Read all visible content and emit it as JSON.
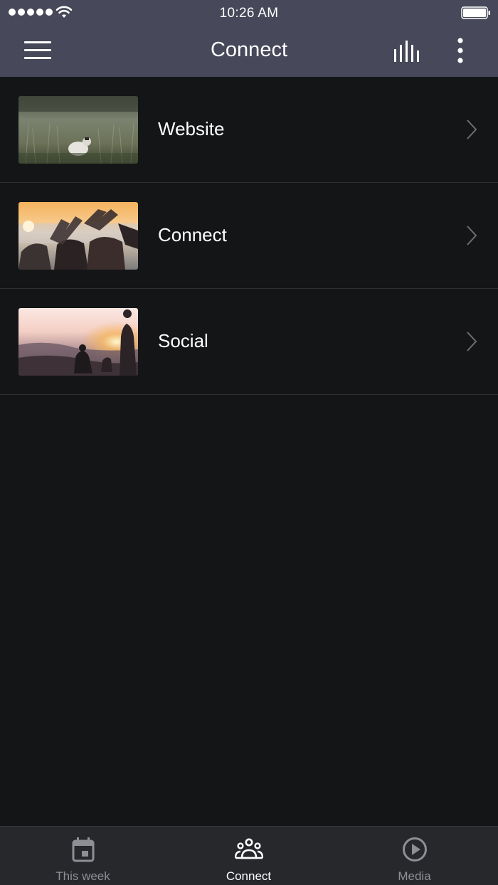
{
  "status_bar": {
    "time": "10:26 AM"
  },
  "navbar": {
    "title": "Connect",
    "menu_icon": "hamburger-menu-icon",
    "chart_icon": "audio-bars-icon",
    "more_icon": "vertical-ellipsis-icon"
  },
  "list": {
    "items": [
      {
        "label": "Website",
        "thumbnail": "dog-in-grass-photo"
      },
      {
        "label": "Connect",
        "thumbnail": "friends-heart-hands-sunset-photo"
      },
      {
        "label": "Social",
        "thumbnail": "people-mountain-sunset-photo"
      }
    ]
  },
  "tabbar": {
    "tabs": [
      {
        "label": "This week",
        "icon": "calendar-icon",
        "active": false
      },
      {
        "label": "Connect",
        "icon": "group-icon",
        "active": true
      },
      {
        "label": "Media",
        "icon": "play-circle-icon",
        "active": false
      }
    ]
  },
  "colors": {
    "header_bg": "#474859",
    "page_bg": "#141517",
    "tabbar_bg": "#27282c",
    "active_tab": "#ffffff",
    "inactive_tab": "#8e8f95",
    "divider": "#2e3036"
  }
}
